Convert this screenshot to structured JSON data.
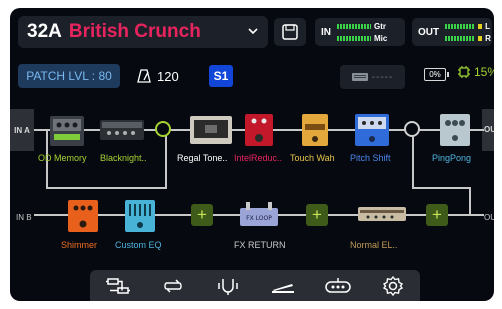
{
  "header": {
    "patch_number": "32A",
    "patch_name": "British Crunch",
    "input_meter": {
      "label": "IN",
      "ch1": "Gtr",
      "ch2": "Mic"
    },
    "output_meter": {
      "label": "OUT",
      "ch1": "L",
      "ch2": "R"
    }
  },
  "status": {
    "patch_level": "PATCH LVL : 80",
    "tempo": "120",
    "snapshot": "S1",
    "amp_readout": "-----",
    "battery": "0%",
    "cpu": "15%"
  },
  "chain": {
    "in_a": "IN A",
    "in_b": "IN B",
    "out_a": "OUT",
    "out_b": "OUT",
    "blocks": [
      {
        "label": "OD Memory",
        "color": "#a5d233"
      },
      {
        "label": "Blacknight..",
        "color": "#a5d233"
      },
      {
        "label": "Regal Tone..",
        "color": "#ffffff"
      },
      {
        "label": "IntelReduc..",
        "color": "#e8245f"
      },
      {
        "label": "Touch Wah",
        "color": "#e5c24a"
      },
      {
        "label": "Pitch Shift",
        "color": "#4d86ee"
      },
      {
        "label": "PingPong",
        "color": "#4fb4e0"
      },
      {
        "label": "Shimmer",
        "color": "#ee6d22"
      },
      {
        "label": "Custom EQ",
        "color": "#4fb4e0"
      },
      {
        "label": "FX RETURN",
        "color": "#c9c9c9"
      },
      {
        "label": "Normal EL..",
        "color": "#c29a5a"
      }
    ]
  },
  "toolbar": {
    "items": [
      "routing-icon",
      "loop-icon",
      "tuner-icon",
      "expression-pedal-icon",
      "footswitch-icon",
      "settings-icon"
    ]
  }
}
